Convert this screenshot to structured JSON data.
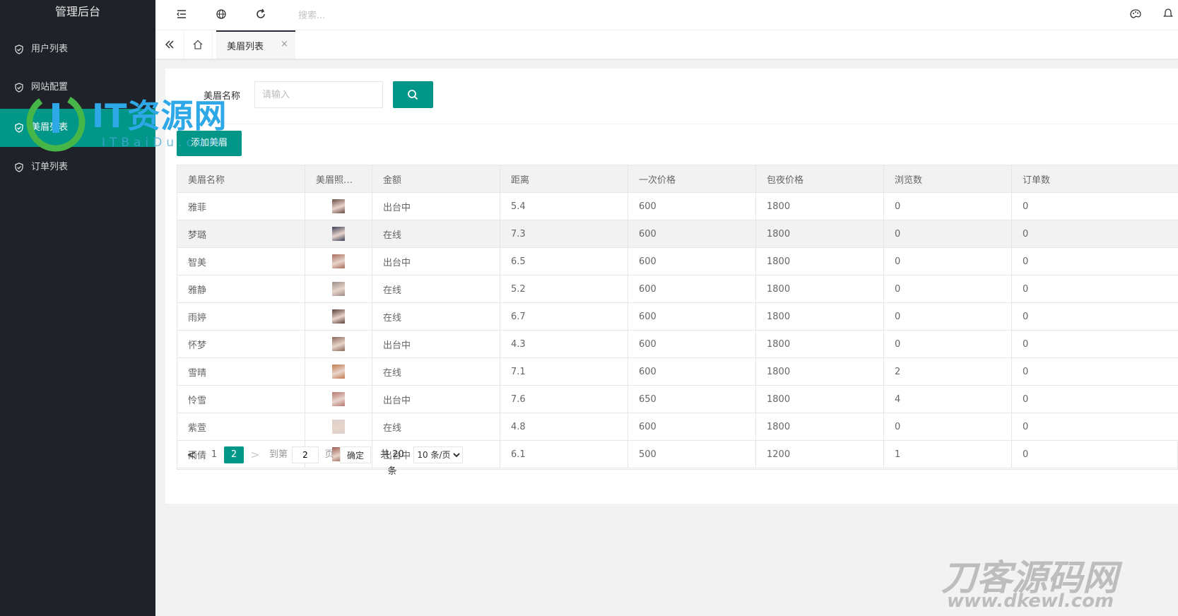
{
  "app": {
    "title": "管理后台"
  },
  "sidebar": {
    "items": [
      {
        "label": "用户列表",
        "active": false
      },
      {
        "label": "网站配置",
        "active": false
      },
      {
        "label": "美眉列表",
        "active": true
      },
      {
        "label": "订单列表",
        "active": false
      }
    ]
  },
  "header": {
    "icons": [
      "menu-fold-icon",
      "globe-icon",
      "refresh-icon",
      "theme-palette-icon",
      "notice-icon"
    ],
    "search_placeholder": "搜索..."
  },
  "tabs": {
    "items": [
      {
        "label": "美眉列表",
        "close": "×"
      }
    ]
  },
  "form": {
    "name_label": "美眉名称",
    "name_placeholder": "请输入",
    "name_value": "",
    "search_button_icon": "search-icon",
    "add_button": "添加美眉"
  },
  "table": {
    "columns": [
      "美眉名称",
      "美眉照片…",
      "金额",
      "距离",
      "一次价格",
      "包夜价格",
      "浏览数",
      "订单数"
    ],
    "rows": [
      {
        "name": "雅菲",
        "photo_color": "#6b4a44",
        "status": "出台中",
        "distance": "5.4",
        "once_price": "600",
        "night_price": "1800",
        "views": "0",
        "orders": "0"
      },
      {
        "name": "梦璐",
        "photo_color": "#3a3f55",
        "status": "在线",
        "distance": "7.3",
        "once_price": "600",
        "night_price": "1800",
        "views": "0",
        "orders": "0"
      },
      {
        "name": "智美",
        "photo_color": "#a76a5a",
        "status": "出台中",
        "distance": "6.5",
        "once_price": "600",
        "night_price": "1800",
        "views": "0",
        "orders": "0"
      },
      {
        "name": "雅静",
        "photo_color": "#9a8d86",
        "status": "在线",
        "distance": "5.2",
        "once_price": "600",
        "night_price": "1800",
        "views": "0",
        "orders": "0"
      },
      {
        "name": "雨婷",
        "photo_color": "#5a3f3a",
        "status": "在线",
        "distance": "6.7",
        "once_price": "600",
        "night_price": "1800",
        "views": "0",
        "orders": "0"
      },
      {
        "name": "怀梦",
        "photo_color": "#8a6656",
        "status": "出台中",
        "distance": "4.3",
        "once_price": "600",
        "night_price": "1800",
        "views": "0",
        "orders": "0"
      },
      {
        "name": "雪晴",
        "photo_color": "#c27a4c",
        "status": "在线",
        "distance": "7.1",
        "once_price": "600",
        "night_price": "1800",
        "views": "2",
        "orders": "0"
      },
      {
        "name": "怜雪",
        "photo_color": "#b5766d",
        "status": "出台中",
        "distance": "7.6",
        "once_price": "650",
        "night_price": "1800",
        "views": "4",
        "orders": "0"
      },
      {
        "name": "紫萱",
        "photo_color": "#d8cfc8",
        "status": "在线",
        "distance": "4.8",
        "once_price": "600",
        "night_price": "1800",
        "views": "0",
        "orders": "0"
      },
      {
        "name": "雨倩",
        "photo_color": "#9c5a4e",
        "status": "出台中",
        "distance": "6.1",
        "once_price": "500",
        "night_price": "1200",
        "views": "1",
        "orders": "0"
      }
    ]
  },
  "pagination": {
    "prev": "<",
    "pages": [
      "1",
      "2"
    ],
    "current": "2",
    "next": ">",
    "goto_prefix": "到第",
    "goto_value": "2",
    "goto_suffix": "页",
    "confirm": "确定",
    "total": "共 20 条",
    "per_page_options": [
      "10 条/页"
    ],
    "per_page_selected": "10 条/页"
  },
  "watermarks": {
    "itbaidu": {
      "title": "IT资源网",
      "sub": "ITBaiDu.com"
    },
    "dkewl": {
      "title": "刀客源码网",
      "sub": "www.dkewl.com"
    }
  },
  "colors": {
    "sidebar_bg": "#20222a",
    "accent": "#009688",
    "page_bg": "#f2f2f2"
  }
}
